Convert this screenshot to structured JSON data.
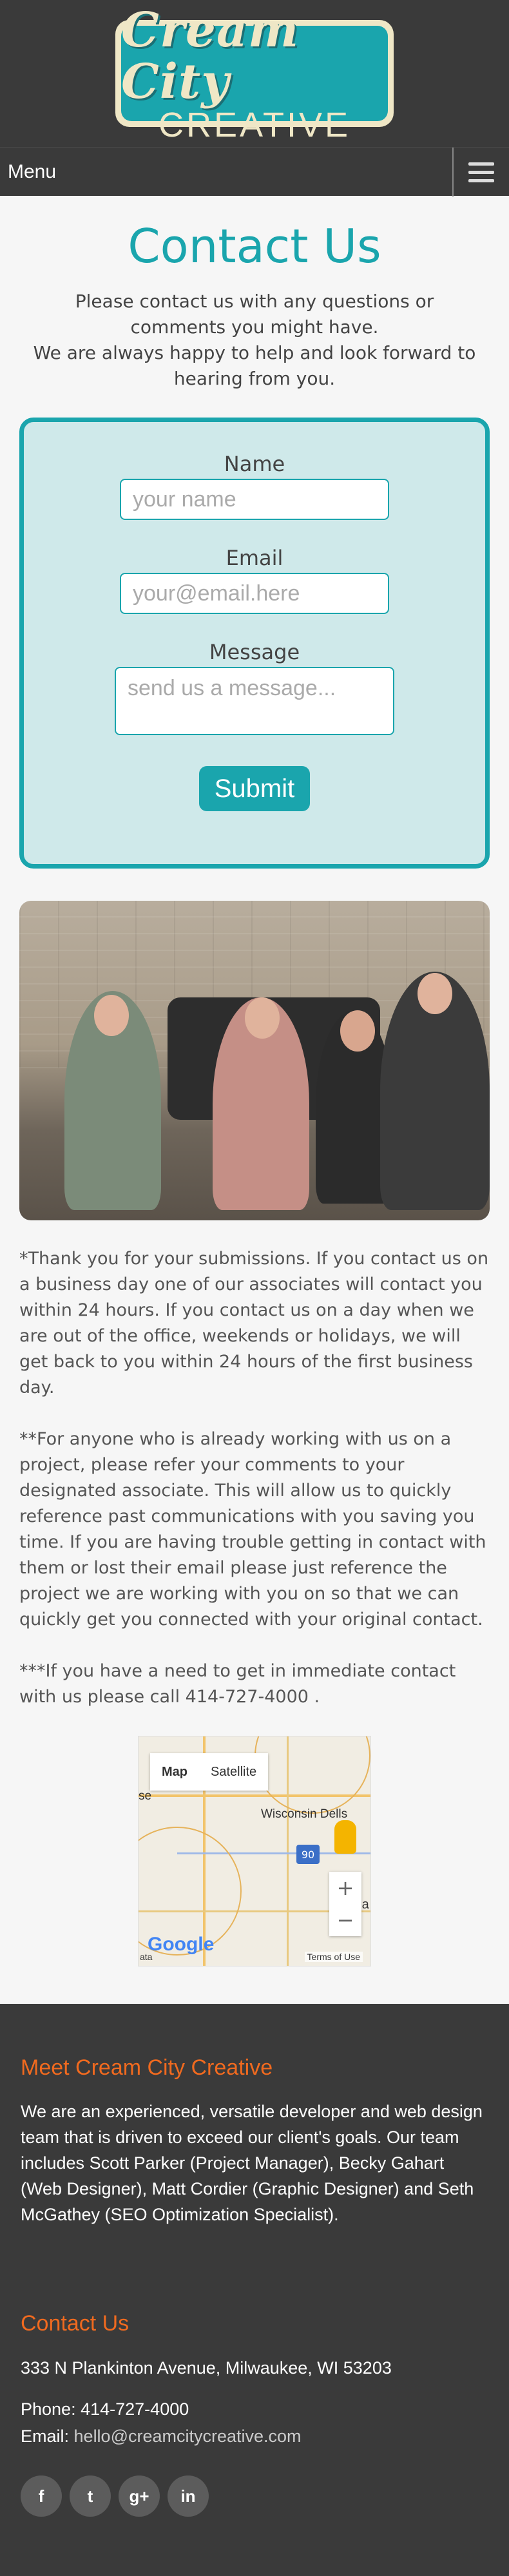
{
  "header": {
    "logo_top": "Cream City",
    "logo_bottom": "CREATIVE"
  },
  "nav": {
    "menu_label": "Menu"
  },
  "main": {
    "title": "Contact Us",
    "intro_line1": "Please contact us with any questions or comments you might have.",
    "intro_line2": "We are always happy to help and look forward to hearing from you.",
    "form": {
      "name_label": "Name",
      "name_placeholder": "your name",
      "email_label": "Email",
      "email_placeholder": "your@email.here",
      "message_label": "Message",
      "message_placeholder": "send us a message...",
      "submit_label": "Submit"
    },
    "notes": [
      "*Thank you for your submissions. If you contact us on a business day one of our associates will contact you within 24 hours. If you contact us on a day when we are out of the office, weekends or holidays, we will get back to you within 24 hours of the first business day.",
      "**For anyone who is already working with us on a project, please refer your comments to your designated associate. This will allow us to quickly reference past communications with you saving you time. If you are having trouble getting in contact with them or lost their email please just reference the project we are working with you on so that we can quickly get you connected with your original contact.",
      "***If you have a need to get in immediate contact with us please call 414-727-4000 ."
    ],
    "map": {
      "map_btn": "Map",
      "satellite_btn": "Satellite",
      "place1": "Wisconsin Dells",
      "place2": "Ma",
      "highway": "90",
      "zoom_in": "+",
      "zoom_out": "−",
      "google": "Google",
      "terms": "Terms of Use",
      "data_left": "ata",
      "edge_left": "se"
    }
  },
  "footer": {
    "about_heading": "Meet Cream City Creative",
    "about_text": "We are an experienced, versatile developer and web design team that is driven to exceed our client's goals. Our team includes Scott Parker (Project Manager), Becky Gahart (Web Designer), Matt Cordier (Graphic Designer) and Seth McGathey (SEO Optimization Specialist).",
    "contact_heading": "Contact Us",
    "address": "333 N Plankinton Avenue, Milwaukee, WI 53203",
    "phone_label": "Phone:",
    "phone": "414-727-4000",
    "email_label": "Email:",
    "email": "hello@creamcitycreative.com",
    "social": {
      "facebook": "f",
      "twitter": "t",
      "googleplus": "g+",
      "linkedin": "in"
    }
  },
  "colors": {
    "accent": "#1aa5ad",
    "footer_heading": "#f06a1f",
    "dark": "#3a3a3a"
  }
}
